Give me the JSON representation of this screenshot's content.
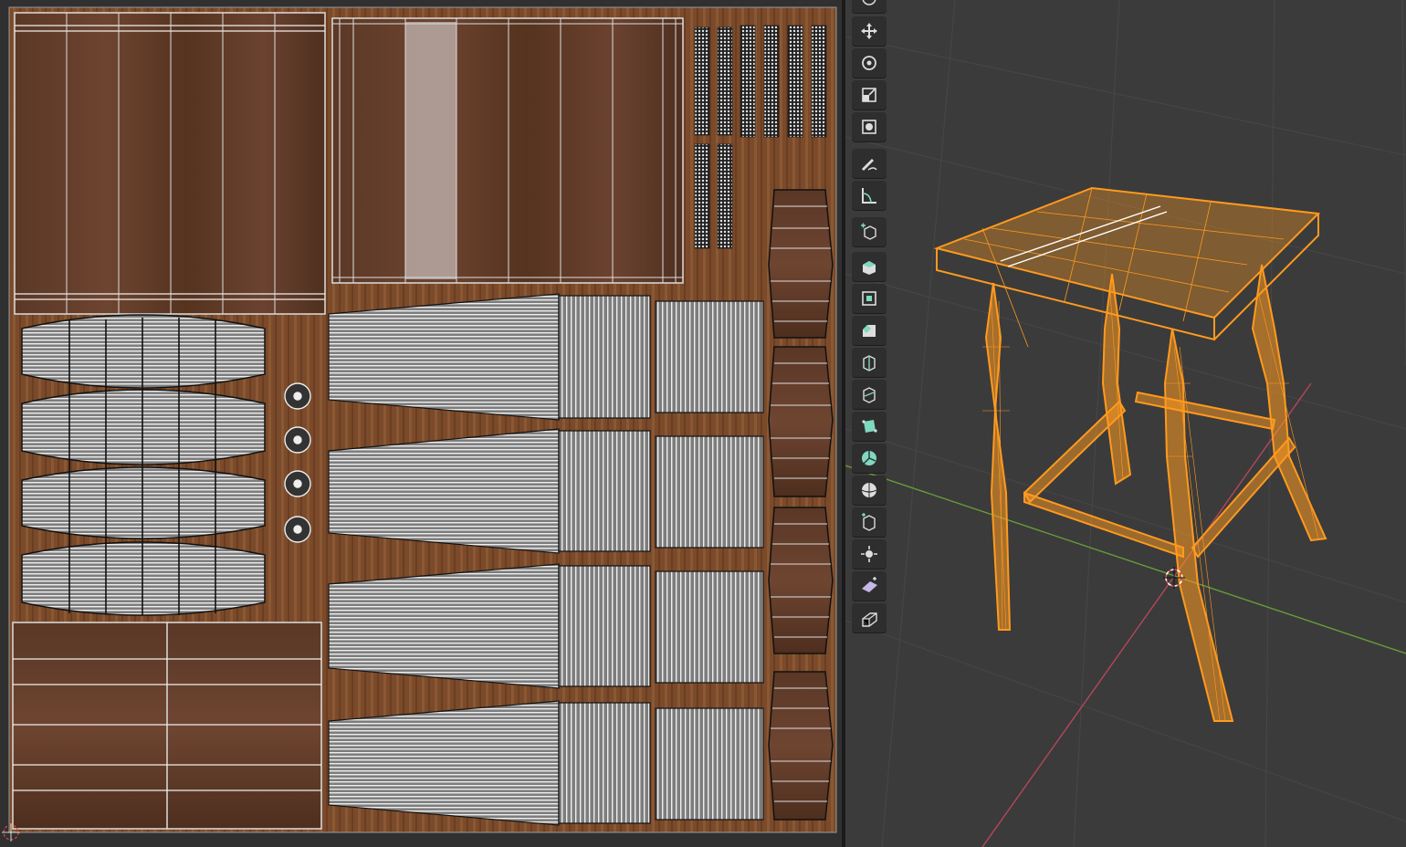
{
  "app": {
    "left_editor": "uv-editor",
    "right_editor": "3d-viewport"
  },
  "colors": {
    "wood_dark": "#5a3a28",
    "wood_mid": "#6e4530",
    "wood_light": "#8a5a3a",
    "uv_island_fill": "#9a9a9a",
    "uv_edge": "#e8e8e8",
    "selection_orange": "#ff9a1f",
    "viewport_bg": "#3b3b3b",
    "grid_line": "#474747",
    "axis_x_red": "#b5475a",
    "axis_y_green": "#6a9a3a",
    "tool_icon_teal": "#7fd8c0"
  },
  "toolbar": {
    "tools": [
      {
        "name": "move-tool",
        "icon": "move-icon"
      },
      {
        "name": "rotate-tool",
        "icon": "rotate-icon"
      },
      {
        "name": "scale-tool",
        "icon": "scale-icon"
      },
      {
        "name": "transform-tool",
        "icon": "transform-icon"
      },
      {
        "name": "annotate-tool",
        "icon": "annotate-icon"
      },
      {
        "name": "measure-tool",
        "icon": "measure-icon"
      },
      {
        "name": "add-cube-tool",
        "icon": "add-cube-icon"
      },
      {
        "name": "extrude-region-tool",
        "icon": "extrude-icon"
      },
      {
        "name": "inset-faces-tool",
        "icon": "inset-icon"
      },
      {
        "name": "bevel-tool",
        "icon": "bevel-icon"
      },
      {
        "name": "loop-cut-tool",
        "icon": "loop-cut-icon"
      },
      {
        "name": "knife-tool",
        "icon": "knife-icon"
      },
      {
        "name": "poly-build-tool",
        "icon": "poly-build-icon"
      },
      {
        "name": "spin-tool",
        "icon": "spin-icon"
      },
      {
        "name": "smooth-tool",
        "icon": "smooth-icon"
      },
      {
        "name": "edge-slide-tool",
        "icon": "edge-slide-icon"
      },
      {
        "name": "shrink-fatten-tool",
        "icon": "shrink-fatten-icon"
      },
      {
        "name": "shear-tool",
        "icon": "shear-icon"
      },
      {
        "name": "rip-region-tool",
        "icon": "rip-icon"
      }
    ]
  }
}
